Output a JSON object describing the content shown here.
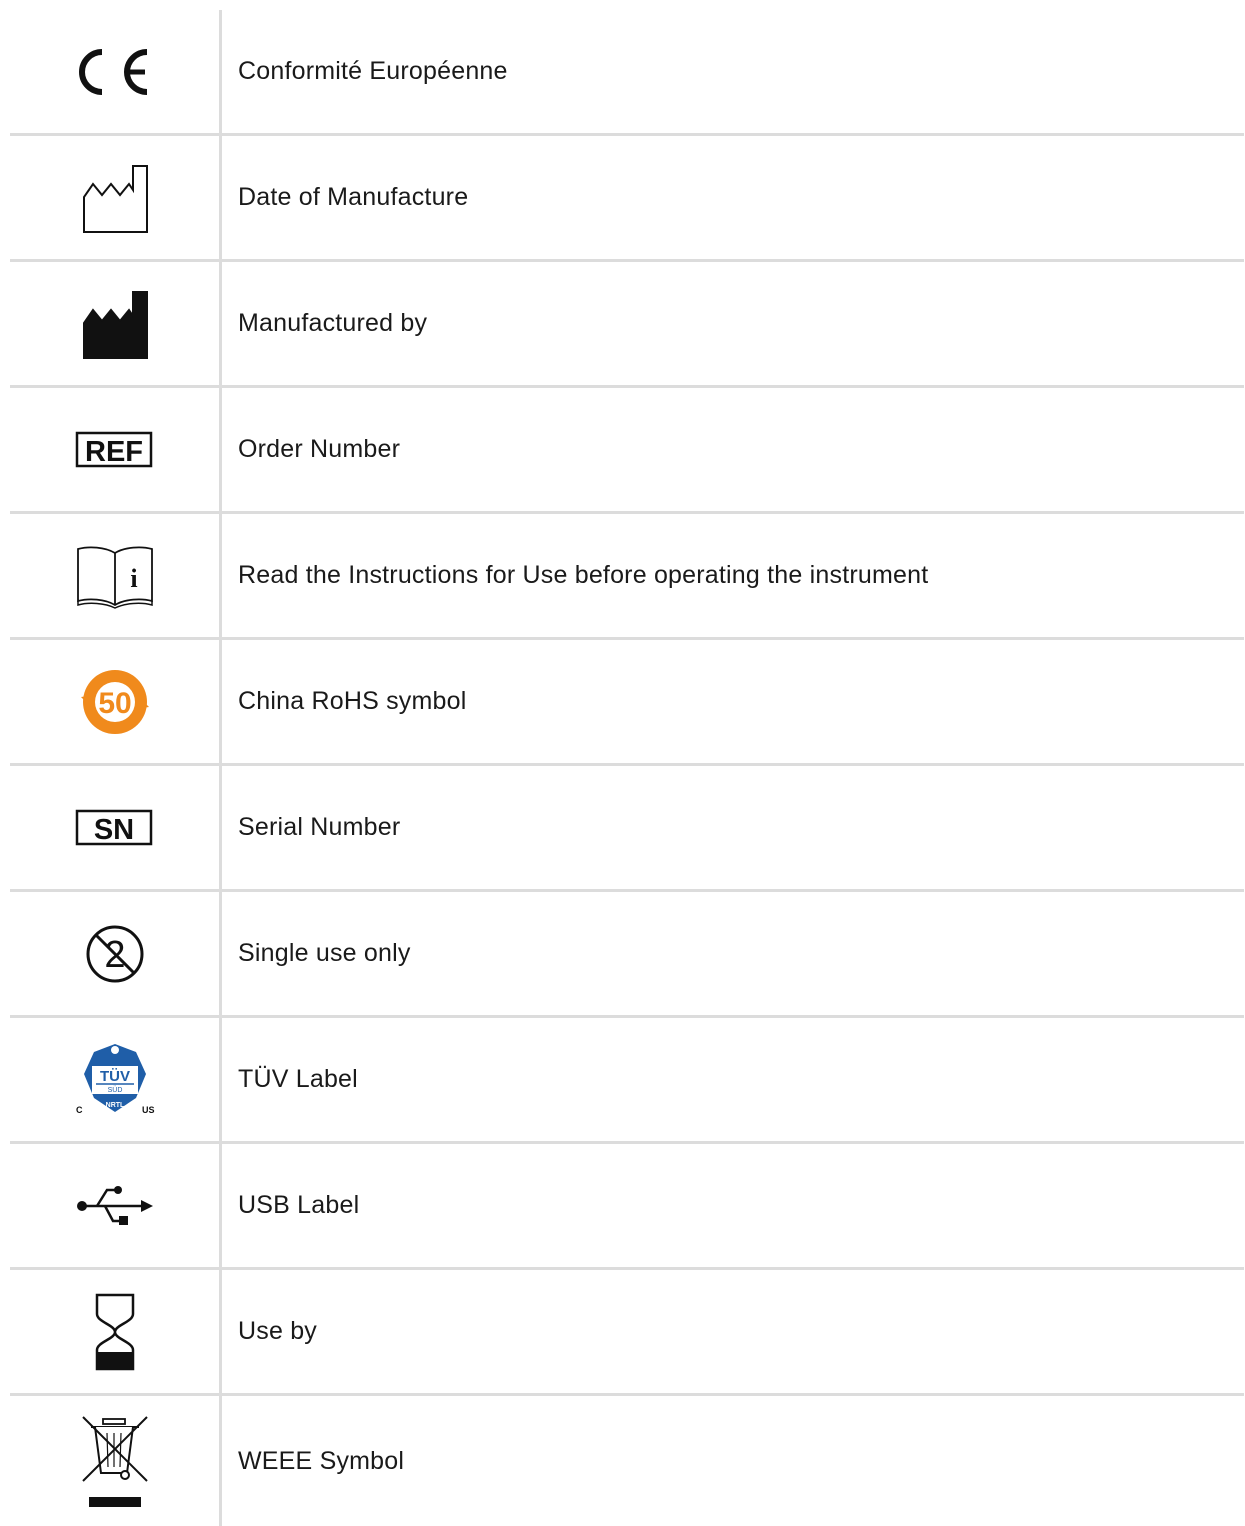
{
  "symbols": [
    {
      "icon": "ce-mark-icon",
      "label": "Conformité Européenne"
    },
    {
      "icon": "date-of-manufacture-icon",
      "label": "Date of Manufacture"
    },
    {
      "icon": "manufacturer-icon",
      "label": "Manufactured by"
    },
    {
      "icon": "ref-icon",
      "icon_text": "REF",
      "label": "Order Number"
    },
    {
      "icon": "instructions-book-icon",
      "icon_text": "i",
      "label": "Read the Instructions for Use before operating the instrument"
    },
    {
      "icon": "china-rohs-icon",
      "icon_text": "50",
      "label": "China RoHS symbol"
    },
    {
      "icon": "serial-number-icon",
      "icon_text": "SN",
      "label": "Serial Number"
    },
    {
      "icon": "single-use-icon",
      "icon_text": "2",
      "label": "Single use only"
    },
    {
      "icon": "tuv-icon",
      "icon_text": {
        "main": "TÜV",
        "sub": "SÜD",
        "nrtl": "NRTL",
        "left": "C",
        "right": "US"
      },
      "label": "TÜV Label"
    },
    {
      "icon": "usb-icon",
      "label": "USB Label"
    },
    {
      "icon": "use-by-icon",
      "label": "Use by"
    },
    {
      "icon": "weee-icon",
      "label": "WEEE Symbol"
    }
  ],
  "colors": {
    "rohs_orange": "#f08a1c",
    "tuv_blue": "#1f5ea8",
    "divider": "#dcdcdc"
  }
}
